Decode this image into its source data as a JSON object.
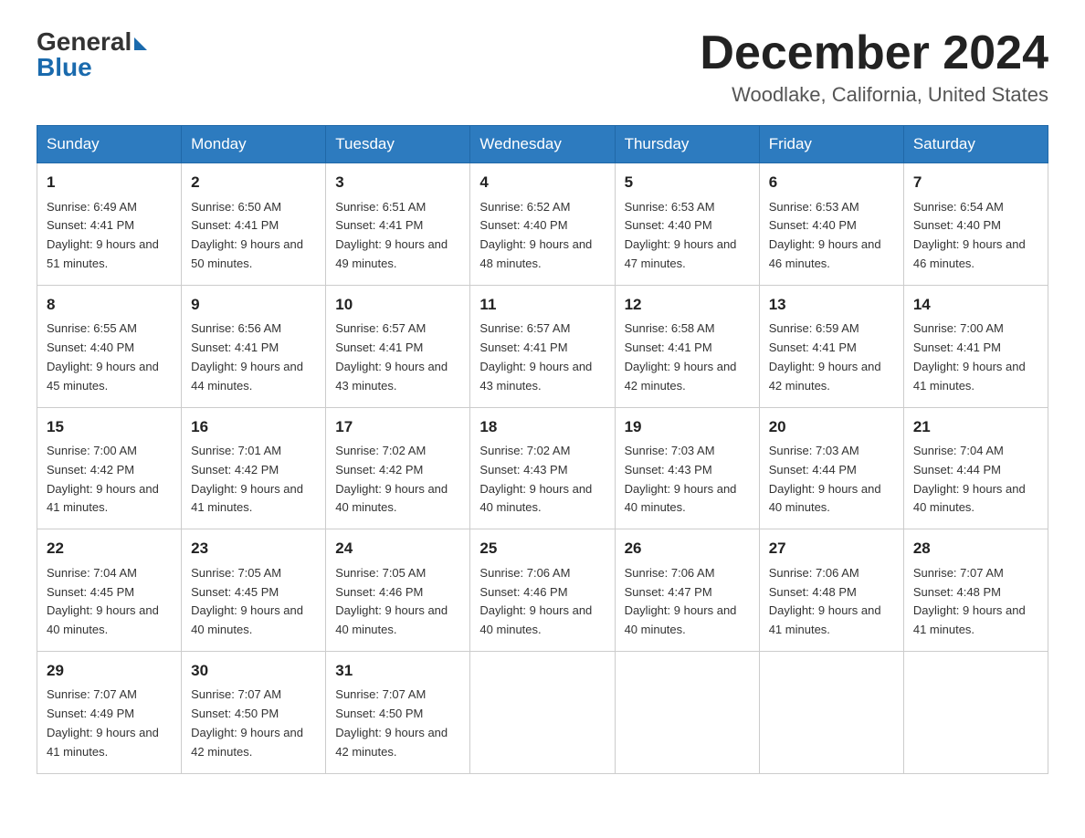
{
  "header": {
    "logo_general": "General",
    "logo_blue": "Blue",
    "month_title": "December 2024",
    "location": "Woodlake, California, United States"
  },
  "days_of_week": [
    "Sunday",
    "Monday",
    "Tuesday",
    "Wednesday",
    "Thursday",
    "Friday",
    "Saturday"
  ],
  "weeks": [
    [
      {
        "day": "1",
        "sunrise": "6:49 AM",
        "sunset": "4:41 PM",
        "daylight": "9 hours and 51 minutes."
      },
      {
        "day": "2",
        "sunrise": "6:50 AM",
        "sunset": "4:41 PM",
        "daylight": "9 hours and 50 minutes."
      },
      {
        "day": "3",
        "sunrise": "6:51 AM",
        "sunset": "4:41 PM",
        "daylight": "9 hours and 49 minutes."
      },
      {
        "day": "4",
        "sunrise": "6:52 AM",
        "sunset": "4:40 PM",
        "daylight": "9 hours and 48 minutes."
      },
      {
        "day": "5",
        "sunrise": "6:53 AM",
        "sunset": "4:40 PM",
        "daylight": "9 hours and 47 minutes."
      },
      {
        "day": "6",
        "sunrise": "6:53 AM",
        "sunset": "4:40 PM",
        "daylight": "9 hours and 46 minutes."
      },
      {
        "day": "7",
        "sunrise": "6:54 AM",
        "sunset": "4:40 PM",
        "daylight": "9 hours and 46 minutes."
      }
    ],
    [
      {
        "day": "8",
        "sunrise": "6:55 AM",
        "sunset": "4:40 PM",
        "daylight": "9 hours and 45 minutes."
      },
      {
        "day": "9",
        "sunrise": "6:56 AM",
        "sunset": "4:41 PM",
        "daylight": "9 hours and 44 minutes."
      },
      {
        "day": "10",
        "sunrise": "6:57 AM",
        "sunset": "4:41 PM",
        "daylight": "9 hours and 43 minutes."
      },
      {
        "day": "11",
        "sunrise": "6:57 AM",
        "sunset": "4:41 PM",
        "daylight": "9 hours and 43 minutes."
      },
      {
        "day": "12",
        "sunrise": "6:58 AM",
        "sunset": "4:41 PM",
        "daylight": "9 hours and 42 minutes."
      },
      {
        "day": "13",
        "sunrise": "6:59 AM",
        "sunset": "4:41 PM",
        "daylight": "9 hours and 42 minutes."
      },
      {
        "day": "14",
        "sunrise": "7:00 AM",
        "sunset": "4:41 PM",
        "daylight": "9 hours and 41 minutes."
      }
    ],
    [
      {
        "day": "15",
        "sunrise": "7:00 AM",
        "sunset": "4:42 PM",
        "daylight": "9 hours and 41 minutes."
      },
      {
        "day": "16",
        "sunrise": "7:01 AM",
        "sunset": "4:42 PM",
        "daylight": "9 hours and 41 minutes."
      },
      {
        "day": "17",
        "sunrise": "7:02 AM",
        "sunset": "4:42 PM",
        "daylight": "9 hours and 40 minutes."
      },
      {
        "day": "18",
        "sunrise": "7:02 AM",
        "sunset": "4:43 PM",
        "daylight": "9 hours and 40 minutes."
      },
      {
        "day": "19",
        "sunrise": "7:03 AM",
        "sunset": "4:43 PM",
        "daylight": "9 hours and 40 minutes."
      },
      {
        "day": "20",
        "sunrise": "7:03 AM",
        "sunset": "4:44 PM",
        "daylight": "9 hours and 40 minutes."
      },
      {
        "day": "21",
        "sunrise": "7:04 AM",
        "sunset": "4:44 PM",
        "daylight": "9 hours and 40 minutes."
      }
    ],
    [
      {
        "day": "22",
        "sunrise": "7:04 AM",
        "sunset": "4:45 PM",
        "daylight": "9 hours and 40 minutes."
      },
      {
        "day": "23",
        "sunrise": "7:05 AM",
        "sunset": "4:45 PM",
        "daylight": "9 hours and 40 minutes."
      },
      {
        "day": "24",
        "sunrise": "7:05 AM",
        "sunset": "4:46 PM",
        "daylight": "9 hours and 40 minutes."
      },
      {
        "day": "25",
        "sunrise": "7:06 AM",
        "sunset": "4:46 PM",
        "daylight": "9 hours and 40 minutes."
      },
      {
        "day": "26",
        "sunrise": "7:06 AM",
        "sunset": "4:47 PM",
        "daylight": "9 hours and 40 minutes."
      },
      {
        "day": "27",
        "sunrise": "7:06 AM",
        "sunset": "4:48 PM",
        "daylight": "9 hours and 41 minutes."
      },
      {
        "day": "28",
        "sunrise": "7:07 AM",
        "sunset": "4:48 PM",
        "daylight": "9 hours and 41 minutes."
      }
    ],
    [
      {
        "day": "29",
        "sunrise": "7:07 AM",
        "sunset": "4:49 PM",
        "daylight": "9 hours and 41 minutes."
      },
      {
        "day": "30",
        "sunrise": "7:07 AM",
        "sunset": "4:50 PM",
        "daylight": "9 hours and 42 minutes."
      },
      {
        "day": "31",
        "sunrise": "7:07 AM",
        "sunset": "4:50 PM",
        "daylight": "9 hours and 42 minutes."
      },
      null,
      null,
      null,
      null
    ]
  ]
}
